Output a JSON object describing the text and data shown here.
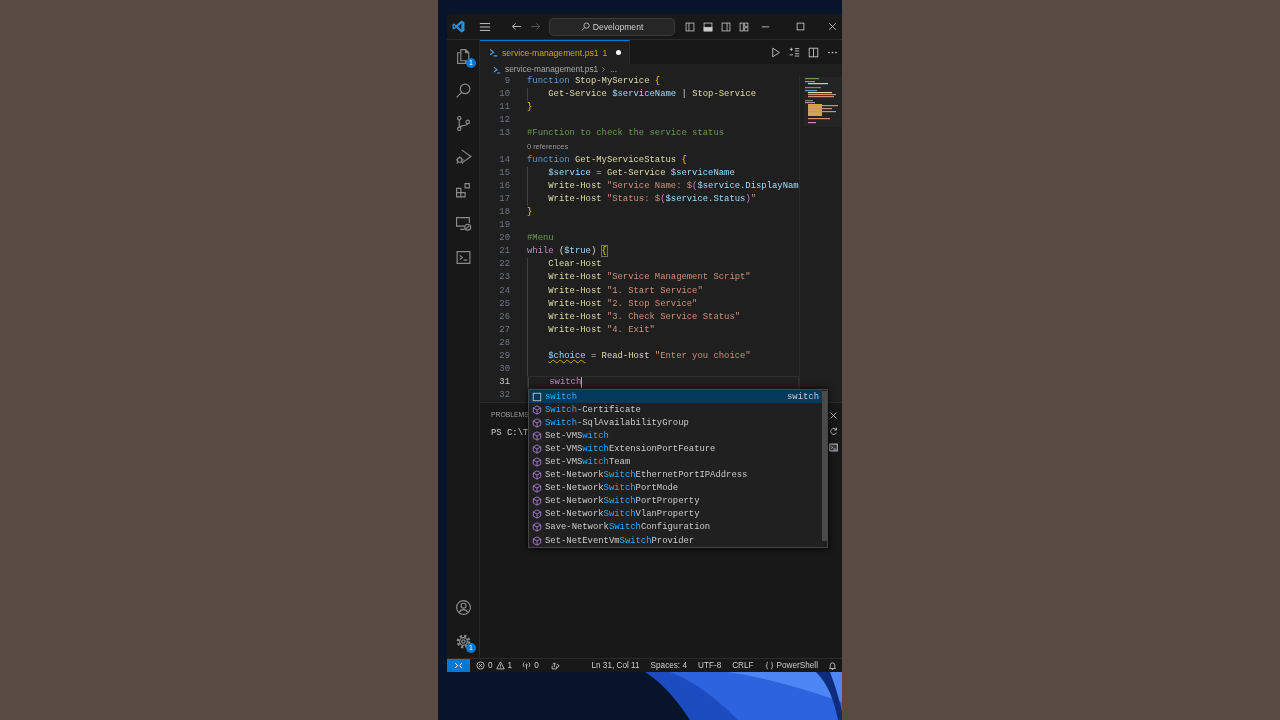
{
  "title_bar": {
    "command_center": "Development",
    "back_disabled": false,
    "forward_disabled": true
  },
  "activity_bar": {
    "top": [
      {
        "kind": "explorer",
        "badge": "1"
      },
      {
        "kind": "search"
      },
      {
        "kind": "source-control"
      },
      {
        "kind": "run-debug"
      },
      {
        "kind": "extensions"
      },
      {
        "kind": "remote-explorer"
      },
      {
        "kind": "terminal"
      }
    ],
    "bottom": [
      {
        "kind": "accounts"
      },
      {
        "kind": "manage",
        "badge": "1"
      }
    ]
  },
  "editor": {
    "tabs": [
      {
        "label": "service-management.ps1",
        "problems": "1",
        "modified": true,
        "warning": true,
        "selected": true
      }
    ],
    "breadcrumb": [
      "service-management.ps1",
      "..."
    ],
    "lines": [
      {
        "number": "9",
        "current": false,
        "indented": false,
        "tokens": [
          {
            "kind": "keyword",
            "text": "function "
          },
          {
            "kind": "function",
            "text": "Stop-MyService "
          },
          {
            "kind": "bracket",
            "text": "{"
          }
        ]
      },
      {
        "number": "10",
        "current": false,
        "indented": true,
        "tokens": [
          {
            "kind": "function",
            "text": "Get-Service "
          },
          {
            "kind": "variable",
            "text": "$serviceName"
          },
          {
            "kind": "plain",
            "text": " | "
          },
          {
            "kind": "function",
            "text": "Stop-Service"
          }
        ]
      },
      {
        "number": "11",
        "current": false,
        "indented": false,
        "tokens": [
          {
            "kind": "bracket",
            "text": "}"
          }
        ]
      },
      {
        "number": "12",
        "current": false,
        "indented": false
      },
      {
        "number": "13",
        "current": false,
        "indented": false,
        "tokens": [
          {
            "kind": "comment",
            "text": "#Function to check the service status"
          }
        ]
      },
      {
        "number": "14",
        "current": false,
        "indented": false,
        "codelens": "0 references",
        "tokens": [
          {
            "kind": "keyword",
            "text": "function "
          },
          {
            "kind": "function",
            "text": "Get-MyServiceStatus "
          },
          {
            "kind": "bracket",
            "text": "{"
          }
        ]
      },
      {
        "number": "15",
        "current": false,
        "indented": true,
        "tokens": [
          {
            "kind": "variable",
            "text": "$service"
          },
          {
            "kind": "plain",
            "text": " = "
          },
          {
            "kind": "function",
            "text": "Get-Service "
          },
          {
            "kind": "variable",
            "text": "$serviceName"
          }
        ]
      },
      {
        "number": "16",
        "current": false,
        "indented": true,
        "tokens": [
          {
            "kind": "function",
            "text": "Write-Host "
          },
          {
            "kind": "string",
            "text": "\"Service Name: $"
          },
          {
            "kind": "bracket2",
            "text": "("
          },
          {
            "kind": "variable",
            "text": "$service.DisplayNam"
          }
        ]
      },
      {
        "number": "17",
        "current": false,
        "indented": true,
        "tokens": [
          {
            "kind": "function",
            "text": "Write-Host "
          },
          {
            "kind": "string",
            "text": "\"Status: $"
          },
          {
            "kind": "bracket2",
            "text": "("
          },
          {
            "kind": "variable",
            "text": "$service.Status"
          },
          {
            "kind": "bracket2",
            "text": ")"
          },
          {
            "kind": "string",
            "text": "\""
          }
        ]
      },
      {
        "number": "18",
        "current": false,
        "indented": false,
        "tokens": [
          {
            "kind": "bracket",
            "text": "}"
          }
        ]
      },
      {
        "number": "19",
        "current": false,
        "indented": false
      },
      {
        "number": "20",
        "current": false,
        "indented": false,
        "tokens": [
          {
            "kind": "comment",
            "text": "#Menu"
          }
        ]
      },
      {
        "number": "21",
        "current": false,
        "indented": false,
        "tokens": [
          {
            "kind": "control",
            "text": "while "
          },
          {
            "kind": "plain",
            "text": "("
          },
          {
            "kind": "variable",
            "text": "$true"
          },
          {
            "kind": "plain",
            "text": ") "
          },
          {
            "kind": "match",
            "text": "{"
          }
        ]
      },
      {
        "number": "22",
        "current": false,
        "indented": true,
        "tokens": [
          {
            "kind": "function",
            "text": "Clear-Host"
          }
        ]
      },
      {
        "number": "23",
        "current": false,
        "indented": true,
        "tokens": [
          {
            "kind": "function",
            "text": "Write-Host "
          },
          {
            "kind": "string",
            "text": "\"Service Management Script\""
          }
        ]
      },
      {
        "number": "24",
        "current": false,
        "indented": true,
        "tokens": [
          {
            "kind": "function",
            "text": "Write-Host "
          },
          {
            "kind": "string",
            "text": "\"1. Start Service\""
          }
        ]
      },
      {
        "number": "25",
        "current": false,
        "indented": true,
        "tokens": [
          {
            "kind": "function",
            "text": "Write-Host "
          },
          {
            "kind": "string",
            "text": "\"2. Stop Service\""
          }
        ]
      },
      {
        "number": "26",
        "current": false,
        "indented": true,
        "tokens": [
          {
            "kind": "function",
            "text": "Write-Host "
          },
          {
            "kind": "string",
            "text": "\"3. Check Service Status\""
          }
        ]
      },
      {
        "number": "27",
        "current": false,
        "indented": true,
        "tokens": [
          {
            "kind": "function",
            "text": "Write-Host "
          },
          {
            "kind": "string",
            "text": "\"4. Exit\""
          }
        ]
      },
      {
        "number": "28",
        "current": false,
        "indented": true
      },
      {
        "number": "29",
        "current": false,
        "indented": true,
        "tokens": [
          {
            "kind": "flagged",
            "text": "$choice"
          },
          {
            "kind": "plain",
            "text": " = "
          },
          {
            "kind": "function",
            "text": "Read-Host "
          },
          {
            "kind": "string",
            "text": "\"Enter you choice\""
          }
        ]
      },
      {
        "number": "30",
        "current": false,
        "indented": true
      },
      {
        "number": "31",
        "current": true,
        "indented": true,
        "tokens": [
          {
            "kind": "control",
            "text": "switch"
          }
        ]
      },
      {
        "number": "32",
        "current": false,
        "indented": false
      }
    ],
    "suggestions": [
      {
        "kind": "keyword",
        "selected": true,
        "parts": [
          {
            "text": "switch",
            "match": true
          }
        ],
        "detail": "switch"
      },
      {
        "kind": "command",
        "selected": false,
        "parts": [
          {
            "text": "Switch",
            "match": true
          },
          {
            "text": "-Certificate",
            "match": false
          }
        ]
      },
      {
        "kind": "command",
        "selected": false,
        "parts": [
          {
            "text": "Switch",
            "match": true
          },
          {
            "text": "-SqlAvailabilityGroup",
            "match": false
          }
        ]
      },
      {
        "kind": "command",
        "selected": false,
        "parts": [
          {
            "text": "Set-VMS",
            "match": false
          },
          {
            "text": "witch",
            "match": true
          }
        ]
      },
      {
        "kind": "command",
        "selected": false,
        "parts": [
          {
            "text": "Set-VMS",
            "match": false
          },
          {
            "text": "witch",
            "match": true
          },
          {
            "text": "ExtensionPortFeature",
            "match": false
          }
        ]
      },
      {
        "kind": "command",
        "selected": false,
        "parts": [
          {
            "text": "Set-VMS",
            "match": false
          },
          {
            "text": "witch",
            "match": true
          },
          {
            "text": "Team",
            "match": false
          }
        ]
      },
      {
        "kind": "command",
        "selected": false,
        "parts": [
          {
            "text": "Set-Network",
            "match": false
          },
          {
            "text": "Switch",
            "match": true
          },
          {
            "text": "EthernetPortIPAddress",
            "match": false
          }
        ]
      },
      {
        "kind": "command",
        "selected": false,
        "parts": [
          {
            "text": "Set-Network",
            "match": false
          },
          {
            "text": "Switch",
            "match": true
          },
          {
            "text": "PortMode",
            "match": false
          }
        ]
      },
      {
        "kind": "command",
        "selected": false,
        "parts": [
          {
            "text": "Set-Network",
            "match": false
          },
          {
            "text": "Switch",
            "match": true
          },
          {
            "text": "PortProperty",
            "match": false
          }
        ]
      },
      {
        "kind": "command",
        "selected": false,
        "parts": [
          {
            "text": "Set-Network",
            "match": false
          },
          {
            "text": "Switch",
            "match": true
          },
          {
            "text": "VlanProperty",
            "match": false
          }
        ]
      },
      {
        "kind": "command",
        "selected": false,
        "parts": [
          {
            "text": "Save-Network",
            "match": false
          },
          {
            "text": "Switch",
            "match": true
          },
          {
            "text": "Configuration",
            "match": false
          }
        ]
      },
      {
        "kind": "command",
        "selected": false,
        "parts": [
          {
            "text": "Set-NetEventVm",
            "match": false
          },
          {
            "text": "Switch",
            "match": true
          },
          {
            "text": "Provider",
            "match": false
          }
        ]
      }
    ]
  },
  "panel": {
    "tab": "PROBLEMS",
    "terminal_text": "PS C:\\T"
  },
  "status_bar": {
    "errors": "0",
    "warnings": "1",
    "ports": "0",
    "position": "Ln 31, Col 11",
    "indentation": "Spaces: 4",
    "encoding": "UTF-8",
    "line_ending": "CRLF",
    "language": "PowerShell"
  }
}
